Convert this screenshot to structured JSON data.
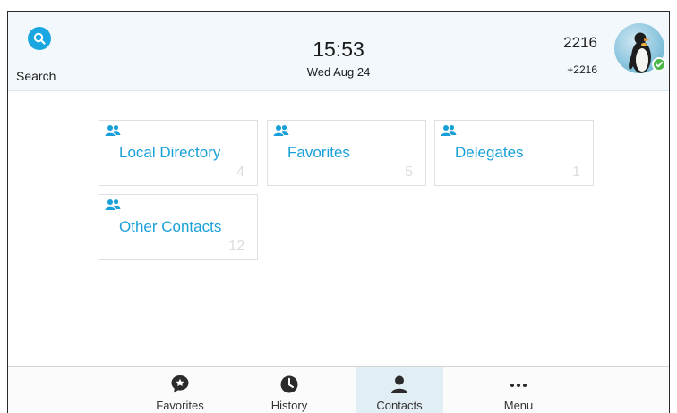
{
  "header": {
    "search_label": "Search",
    "time": "15:53",
    "date": "Wed Aug 24",
    "account_number": "2216",
    "account_extension": "+2216",
    "status": "online"
  },
  "contacts": {
    "groups": [
      {
        "label": "Local Directory",
        "count": "4"
      },
      {
        "label": "Favorites",
        "count": "5"
      },
      {
        "label": "Delegates",
        "count": "1"
      },
      {
        "label": "Other Contacts",
        "count": "12"
      }
    ]
  },
  "nav": {
    "items": [
      {
        "label": "Favorites",
        "icon": "star-speech-icon"
      },
      {
        "label": "History",
        "icon": "clock-icon"
      },
      {
        "label": "Contacts",
        "icon": "person-icon",
        "active": true
      },
      {
        "label": "Menu",
        "icon": "more-dots-icon"
      }
    ]
  },
  "colors": {
    "accent": "#1aa0d8",
    "header_bg": "#f2f8fb",
    "active_tab": "#e1eef3",
    "presence_online": "#4cb648"
  }
}
